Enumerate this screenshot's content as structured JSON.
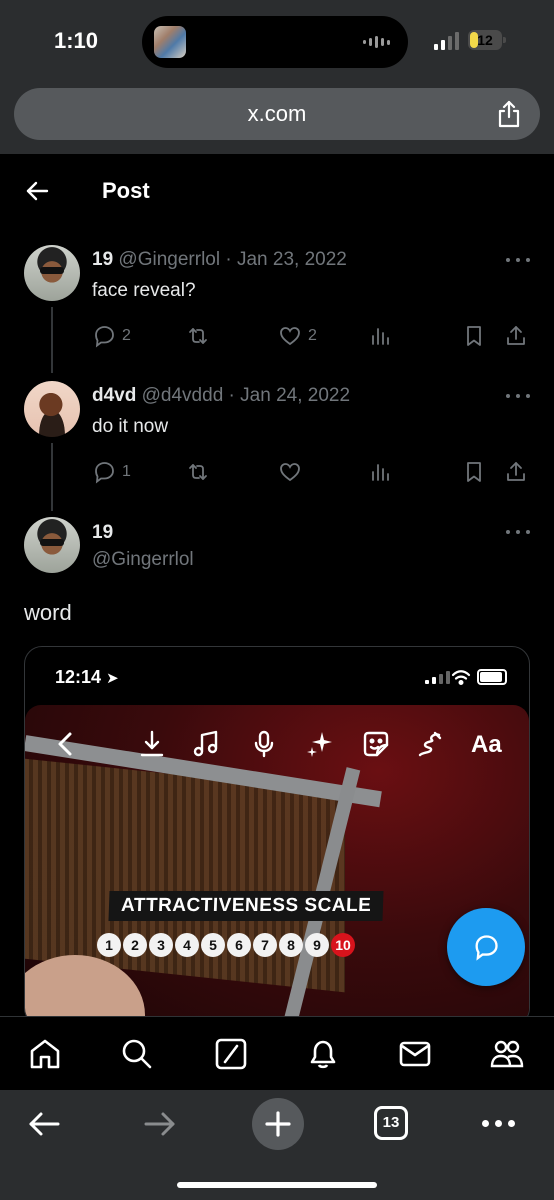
{
  "status_bar": {
    "time": "1:10",
    "battery": "12"
  },
  "browser": {
    "url": "x.com",
    "tab_count": "13"
  },
  "header": {
    "title": "Post"
  },
  "replies": [
    {
      "name": "19",
      "handle": "@Gingerrlol",
      "date": "Jan 23, 2022",
      "text": "face reveal?",
      "replies": "2",
      "likes": "2"
    },
    {
      "name": "d4vd",
      "handle": "@d4vddd",
      "date": "Jan 24, 2022",
      "text": "do it now",
      "replies": "1",
      "likes": ""
    }
  ],
  "main_post": {
    "name": "19",
    "handle": "@Gingerrlol",
    "text": "word",
    "media": {
      "time": "12:14",
      "text_tool": "Aa",
      "scale_label": "ATTRACTIVENESS SCALE",
      "scale_numbers": [
        "1",
        "2",
        "3",
        "4",
        "5",
        "6",
        "7",
        "8",
        "9",
        "10"
      ]
    }
  },
  "icons": {
    "accent": "#1d9bf0",
    "muted": "#71767b",
    "nav": [
      "home-icon",
      "search-icon",
      "grok-icon",
      "notifications-icon",
      "messages-icon",
      "communities-icon"
    ]
  }
}
